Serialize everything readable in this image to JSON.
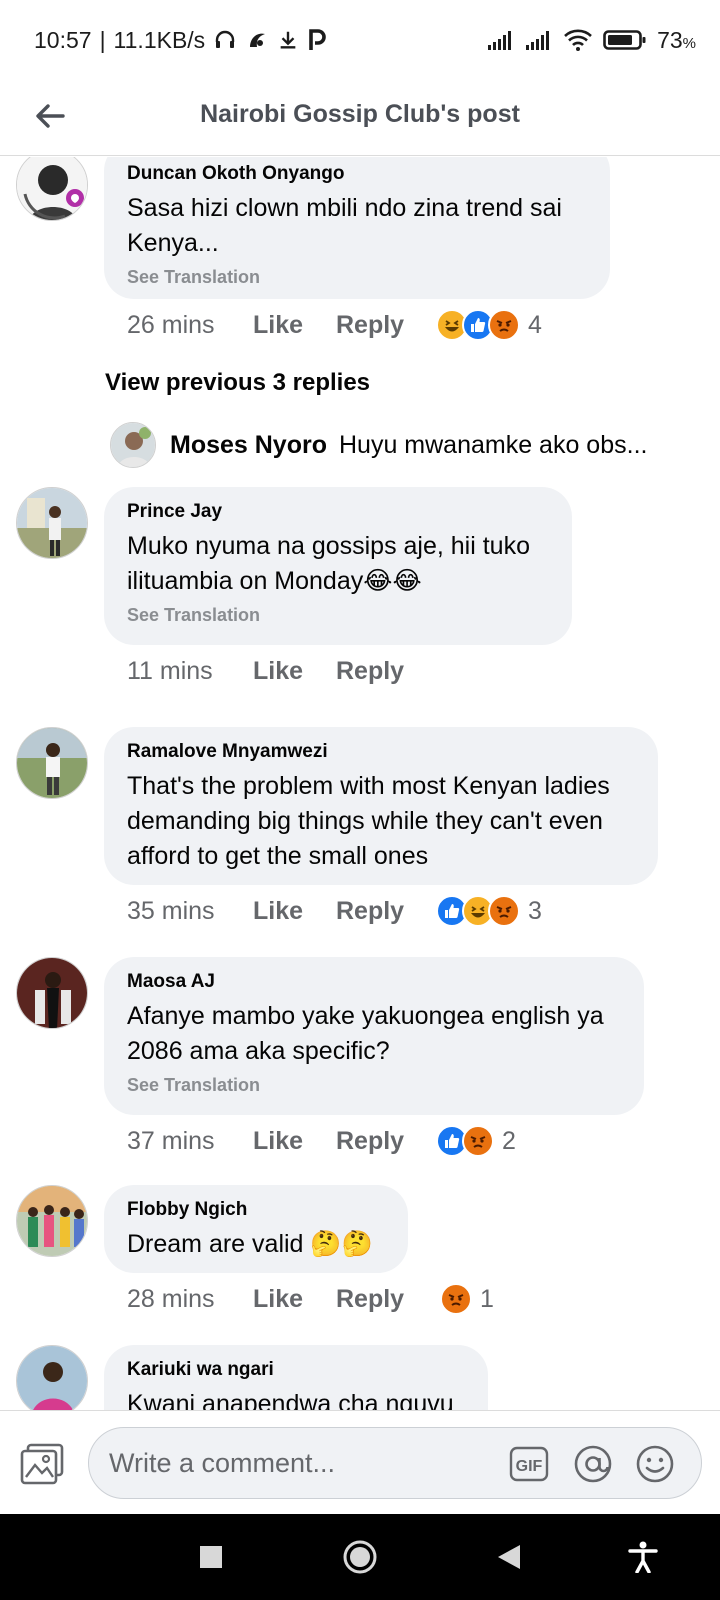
{
  "status_bar": {
    "time": "10:57",
    "speed": "11.1KB/s",
    "battery": "73",
    "battery_unit": "%",
    "icons": [
      "headphones-icon",
      "music-app-icon",
      "download-icon",
      "parking-app-icon",
      "signal-icon",
      "signal-icon",
      "wifi-icon",
      "battery-icon"
    ]
  },
  "header": {
    "title": "Nairobi Gossip Club's post",
    "back_icon": "arrow-left-icon"
  },
  "view_previous": "View previous 3 replies",
  "reply_preview": {
    "name": "Moses Nyoro",
    "text": "Huyu mwanamke ako obs..."
  },
  "comments": [
    {
      "author": "Duncan Okoth Onyango",
      "text": "Sasa hizi clown mbili ndo zina trend sai Kenya...",
      "see_translation": "See Translation",
      "time": "26 mins",
      "like": "Like",
      "reply": "Reply",
      "reactions": [
        "haha",
        "like",
        "angry"
      ],
      "reaction_count": "4"
    },
    {
      "author": "Prince Jay",
      "text": "Muko nyuma na gossips aje, hii tuko ilituambia on Monday😂😂",
      "see_translation": "See Translation",
      "time": "11 mins",
      "like": "Like",
      "reply": "Reply",
      "reactions": [],
      "reaction_count": ""
    },
    {
      "author": "Ramalove Mnyamwezi",
      "text": "That's the problem with most Kenyan ladies demanding big things while they can't even afford to get the small ones",
      "see_translation": "",
      "time": "35 mins",
      "like": "Like",
      "reply": "Reply",
      "reactions": [
        "like",
        "haha",
        "angry"
      ],
      "reaction_count": "3"
    },
    {
      "author": "Maosa AJ",
      "text": "Afanye mambo yake yakuongea english ya 2086 ama aka specific?",
      "see_translation": "See Translation",
      "time": "37 mins",
      "like": "Like",
      "reply": "Reply",
      "reactions": [
        "like",
        "angry"
      ],
      "reaction_count": "2"
    },
    {
      "author": "Flobby Ngich",
      "text": "Dream are valid 🤔🤔",
      "see_translation": "",
      "time": "28 mins",
      "like": "Like",
      "reply": "Reply",
      "reactions": [
        "angry"
      ],
      "reaction_count": "1"
    },
    {
      "author": "Kariuki wa ngari",
      "text": "Kwani anapendwa cha nguvu",
      "see_translation": "",
      "time": "",
      "like": "",
      "reply": "",
      "reactions": [],
      "reaction_count": ""
    }
  ],
  "composer": {
    "placeholder": "Write a comment...",
    "gif_label": "GIF"
  },
  "colors": {
    "bubble": "#f0f2f5",
    "like_blue": "#1877f2",
    "angry_orange": "#e9710f",
    "haha_yellow": "#f7b125",
    "meta_gray": "#65676b"
  }
}
